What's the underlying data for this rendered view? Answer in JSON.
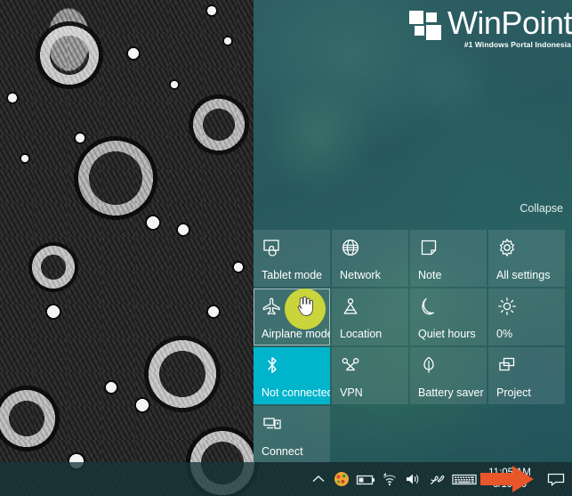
{
  "branding": {
    "logo_mark": "winpoint-squares-logo",
    "wordmark": "WinPoint",
    "tagline": "#1 Windows Portal Indonesia"
  },
  "action_center": {
    "collapse_label": "Collapse",
    "accent_active_color": "#00b4cc",
    "panel_tint_color": "#2b6060",
    "tiles": [
      {
        "id": "tablet-mode",
        "label": "Tablet mode",
        "icon": "tablet-mode-icon",
        "state": "inactive"
      },
      {
        "id": "network",
        "label": "Network",
        "icon": "globe-icon",
        "state": "inactive"
      },
      {
        "id": "note",
        "label": "Note",
        "icon": "note-icon",
        "state": "inactive"
      },
      {
        "id": "all-settings",
        "label": "All settings",
        "icon": "gear-icon",
        "state": "inactive"
      },
      {
        "id": "airplane-mode",
        "label": "Airplane mode",
        "icon": "airplane-icon",
        "state": "focused"
      },
      {
        "id": "location",
        "label": "Location",
        "icon": "location-icon",
        "state": "inactive"
      },
      {
        "id": "quiet-hours",
        "label": "Quiet hours",
        "icon": "moon-icon",
        "state": "inactive"
      },
      {
        "id": "brightness",
        "label": "0%",
        "icon": "brightness-icon",
        "state": "inactive"
      },
      {
        "id": "bluetooth",
        "label": "Not connected",
        "icon": "bluetooth-icon",
        "state": "active"
      },
      {
        "id": "vpn",
        "label": "VPN",
        "icon": "vpn-icon",
        "state": "inactive"
      },
      {
        "id": "battery-saver",
        "label": "Battery saver",
        "icon": "leaf-icon",
        "state": "inactive"
      },
      {
        "id": "project",
        "label": "Project",
        "icon": "project-icon",
        "state": "inactive"
      },
      {
        "id": "connect",
        "label": "Connect",
        "icon": "connect-icon",
        "state": "inactive"
      }
    ]
  },
  "taskbar": {
    "tray": [
      {
        "id": "show-hidden-icons",
        "icon": "chevron-up-icon"
      },
      {
        "id": "tray-app",
        "icon": "app-icon"
      },
      {
        "id": "battery",
        "icon": "battery-icon"
      },
      {
        "id": "wifi",
        "icon": "wifi-icon"
      },
      {
        "id": "volume",
        "icon": "volume-icon"
      },
      {
        "id": "pen",
        "icon": "pen-icon"
      },
      {
        "id": "touch-keyboard",
        "icon": "keyboard-icon"
      }
    ],
    "clock": {
      "time": "11:05 AM",
      "date": "6/19/20"
    },
    "action_center_icon": "speech-bubble-icon"
  },
  "annotation": {
    "arrow": "orange-arrow-pointing-right",
    "arrow_color": "#e8562a"
  },
  "cursor": {
    "type": "hand-pointer",
    "click_highlight_color": "#c9d53a"
  },
  "desktop": {
    "wallpaper": "abstract-black-white-doodle-art"
  }
}
